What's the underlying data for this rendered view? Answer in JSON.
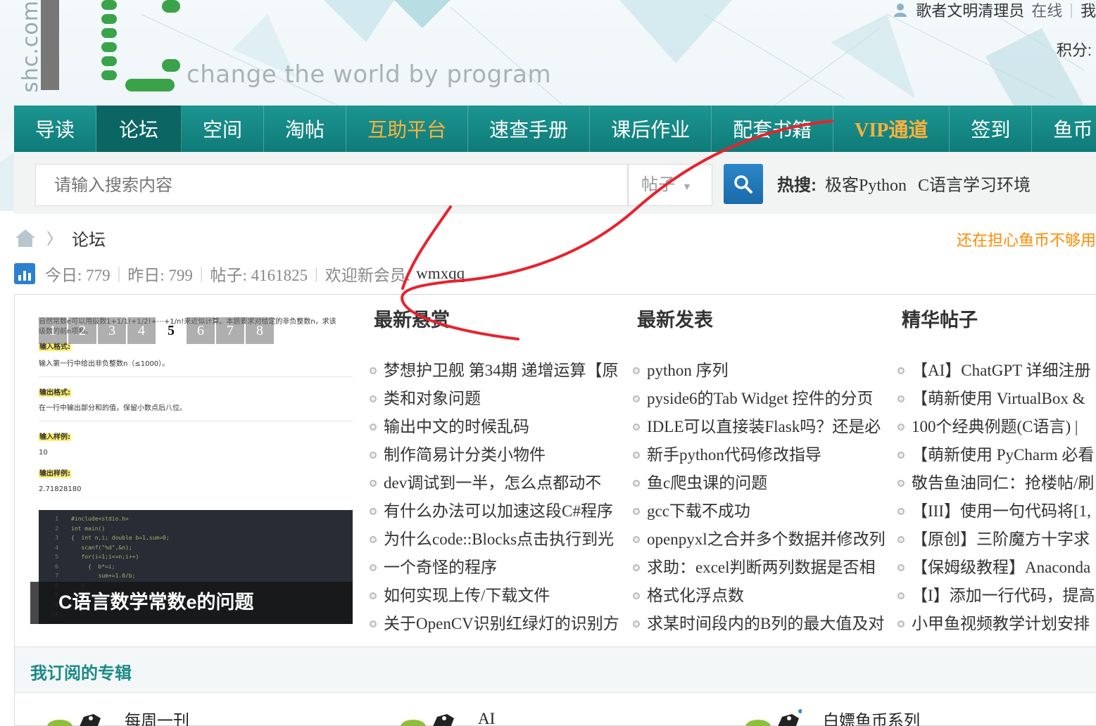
{
  "header": {
    "site_vertical": "shc.com",
    "slogan": "change the world by program",
    "user": {
      "username": "歌者文明清理员",
      "status": "在线",
      "extra": "我",
      "credit_label": "积分:"
    }
  },
  "nav": {
    "items": [
      {
        "label": "导读"
      },
      {
        "label": "论坛"
      },
      {
        "label": "空间"
      },
      {
        "label": "淘帖"
      },
      {
        "label": "互助平台"
      },
      {
        "label": "速查手册"
      },
      {
        "label": "课后作业"
      },
      {
        "label": "配套书籍"
      },
      {
        "label": "VIP通道"
      },
      {
        "label": "签到"
      },
      {
        "label": "鱼币"
      }
    ]
  },
  "search": {
    "placeholder": "请输入搜索内容",
    "type": "帖子",
    "hot_label": "热搜:",
    "hot_keywords": [
      "极客Python",
      "C语言学习环境"
    ]
  },
  "breadcrumb": {
    "current": "论坛"
  },
  "promo": "还在担心鱼币不够用",
  "stats": {
    "today": "今日: 779",
    "yesterday": "昨日: 799",
    "posts": "帖子: 4161825",
    "welcome": "欢迎新会员:",
    "new_member": "wmxqq"
  },
  "slide": {
    "pages": [
      "1",
      "2",
      "3",
      "4",
      "5",
      "6",
      "7",
      "8"
    ],
    "current_page": "5",
    "caption": "C语言数学常数e的问题",
    "doc": {
      "intro": "自然常数e可以用级数1+1/1!+1/2!+⋯+1/n!来近似计算。本题要求对给定的非负整数n，求该级数的前n项和。",
      "input_format_label": "输入格式:",
      "input_format": "输入第一行中给出非负整数n（≤1000）。",
      "output_format_label": "输出格式:",
      "output_format": "在一行中输出部分和的值，保留小数点后八位。",
      "input_sample_label": "输入样例:",
      "input_sample": "10",
      "output_sample_label": "输出样例:",
      "output_sample": "2.71828180"
    },
    "code_lines": [
      "1",
      "2",
      "3",
      "4",
      "5",
      "6",
      "7",
      "8",
      "9",
      "10",
      "11"
    ],
    "code": "#include<stdio.h>\nint main()\n{  int n,i; double b=1,sum=0;\n   scanf(\"%d\",&n);\n   for(i=1;i<=n;i++)\n     {  b*=i;\n        sum+=1.0/b;\n   }"
  },
  "columns": {
    "reward": {
      "title": "最新悬赏",
      "items": [
        "梦想护卫舰 第34期 递增运算【原",
        "类和对象问题",
        "输出中文的时候乱码",
        "制作简易计分类小物件",
        "dev调试到一半，怎么点都动不",
        "有什么办法可以加速这段C#程序",
        "为什么code::Blocks点击执行到光",
        "一个奇怪的程序",
        "如何实现上传/下载文件",
        "关于OpenCV识别红绿灯的识别方"
      ]
    },
    "latest": {
      "title": "最新发表",
      "items": [
        "python 序列",
        "pyside6的Tab Widget 控件的分页",
        "IDLE可以直接装Flask吗？还是必",
        "新手python代码修改指导",
        "鱼c爬虫课的问题",
        "gcc下载不成功",
        "openpyxl之合并多个数据并修改列",
        "求助：excel判断两列数据是否相",
        "格式化浮点数",
        "求某时间段内的B列的最大值及对"
      ]
    },
    "elite": {
      "title": "精华帖子",
      "items": [
        "【AI】ChatGPT 详细注册",
        "【萌新使用 VirtualBox &",
        "100个经典例题(C语言) |",
        "【萌新使用 PyCharm 必看",
        "敬告鱼油同仁：抢楼帖/刷",
        "【III】使用一句代码将[1,",
        "【原创】三阶魔方十字求",
        "【保姆级教程】Anaconda",
        "【I】添加一行代码，提高",
        "小甲鱼视频教学计划安排"
      ]
    }
  },
  "subscriptions": {
    "title": "我订阅的专辑",
    "items": [
      "每周一刊",
      "AI",
      "白嫖鱼币系列"
    ]
  },
  "colors": {
    "nav_teal": "#14898a",
    "highlight_orange": "#ffb13b",
    "promo_orange": "#ff8a00",
    "annotation_red": "#e8222c"
  }
}
